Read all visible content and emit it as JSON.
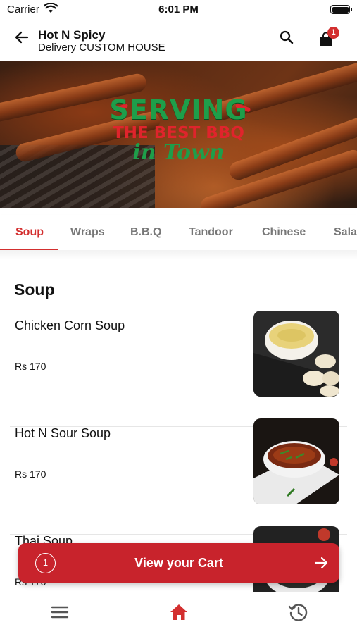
{
  "status_bar": {
    "carrier": "Carrier",
    "time": "6:01 PM"
  },
  "header": {
    "store_name": "Hot N Spicy",
    "delivery_line": "Delivery CUSTOM HOUSE",
    "cart_badge_count": "1"
  },
  "banner": {
    "line1": "SERVING",
    "line2": "THE BEST BBQ",
    "line3": "in Town"
  },
  "tabs": [
    {
      "label": "Soup",
      "active": true
    },
    {
      "label": "Wraps"
    },
    {
      "label": "B.B.Q"
    },
    {
      "label": "Tandoor"
    },
    {
      "label": "Chinese"
    },
    {
      "label": "Salad"
    }
  ],
  "section": {
    "title": "Soup"
  },
  "items": [
    {
      "name": "Chicken Corn Soup",
      "price": "Rs 170"
    },
    {
      "name": "Hot N Sour Soup",
      "price": "Rs 170"
    },
    {
      "name": "Thai Soup",
      "price": "Rs 170"
    }
  ],
  "cart_bar": {
    "count": "1",
    "label": "View your Cart"
  },
  "bottom_nav": {
    "items": [
      "menu-icon",
      "home-icon",
      "history-icon"
    ],
    "active": "home-icon"
  },
  "colors": {
    "accent": "#d32f2f",
    "cart_bar": "#c8232c",
    "banner_green": "#1e9e4a"
  }
}
